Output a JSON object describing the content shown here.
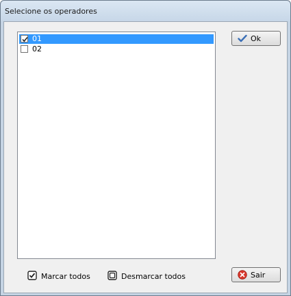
{
  "window": {
    "title": "Selecione os operadores"
  },
  "list": {
    "items": [
      {
        "label": "01",
        "checked": true,
        "selected": true
      },
      {
        "label": "02",
        "checked": false,
        "selected": false
      }
    ]
  },
  "buttons": {
    "ok_label": "Ok",
    "exit_label": "Sair",
    "check_all_label": "Marcar todos",
    "uncheck_all_label": "Desmarcar todos"
  },
  "colors": {
    "selection": "#3399ff",
    "ok_icon": "#3b6fb6",
    "exit_icon": "#d9362b"
  },
  "icons": {
    "ok": "checkmark-icon",
    "exit": "close-circle-icon",
    "check_all": "checked-box-icon",
    "uncheck_all": "empty-box-icon"
  }
}
